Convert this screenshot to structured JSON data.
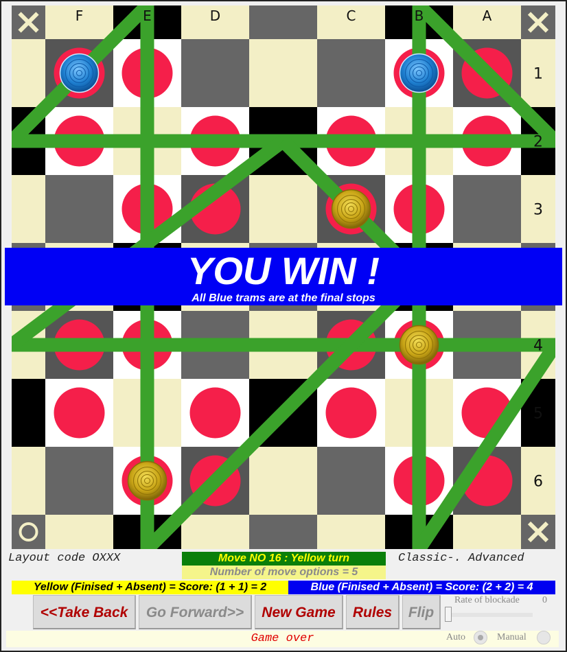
{
  "board": {
    "column_labels": [
      "F",
      "E",
      "D",
      "",
      "C",
      "B",
      "A"
    ],
    "row_labels": [
      "1",
      "2",
      "3",
      "",
      "4",
      "5",
      "6"
    ],
    "corner_icons": {
      "top_left": "x-icon",
      "top_right": "x-icon",
      "bottom_left": "circle-icon",
      "bottom_right": "x-icon"
    },
    "stops": [
      "F1",
      "E1",
      "B1",
      "A1",
      "F2",
      "D2",
      "C2",
      "A2",
      "E3",
      "D3",
      "C3",
      "B3",
      "F4",
      "E4",
      "C4",
      "B4",
      "F5",
      "D5",
      "C5",
      "A5",
      "E6",
      "D6",
      "B6",
      "A6"
    ],
    "pieces": [
      {
        "color": "blue",
        "cell": "F1"
      },
      {
        "color": "blue",
        "cell": "B1"
      },
      {
        "color": "yellow",
        "cell": "C3"
      },
      {
        "color": "yellow",
        "cell": "B4"
      },
      {
        "color": "yellow",
        "cell": "E6"
      }
    ],
    "colors": {
      "track": "#3ba22b",
      "stop": "#f51f4a",
      "beige": "#f3efc6",
      "gray": "#666666",
      "dark": "#555555",
      "blue_piece": "#1e88d8",
      "yellow_piece": "#c9a516"
    }
  },
  "banner": {
    "title": "YOU WIN !",
    "subtitle": "All Blue trams are at the final stops"
  },
  "info": {
    "layout_code": "Layout code OXXX",
    "variant": "Classic-. Advanced",
    "move": "Move NO 16 : Yellow turn",
    "options": "Number of move options = 5",
    "yellow_score": "Yellow (Finised + Absent) = Score: (1 + 1) = 2",
    "blue_score": "Blue (Finised + Absent) = Score: (2 + 2) = 4"
  },
  "buttons": {
    "take_back": "<<Take Back",
    "go_forward": "Go Forward>>",
    "new_game": "New Game",
    "rules": "Rules",
    "flip": "Flip"
  },
  "blockade": {
    "label": "Rate of blockade",
    "value": "0",
    "slider_value": 0
  },
  "status": {
    "text": "Game over"
  },
  "mode": {
    "auto": "Auto",
    "manual": "Manual",
    "selected": "Auto"
  }
}
